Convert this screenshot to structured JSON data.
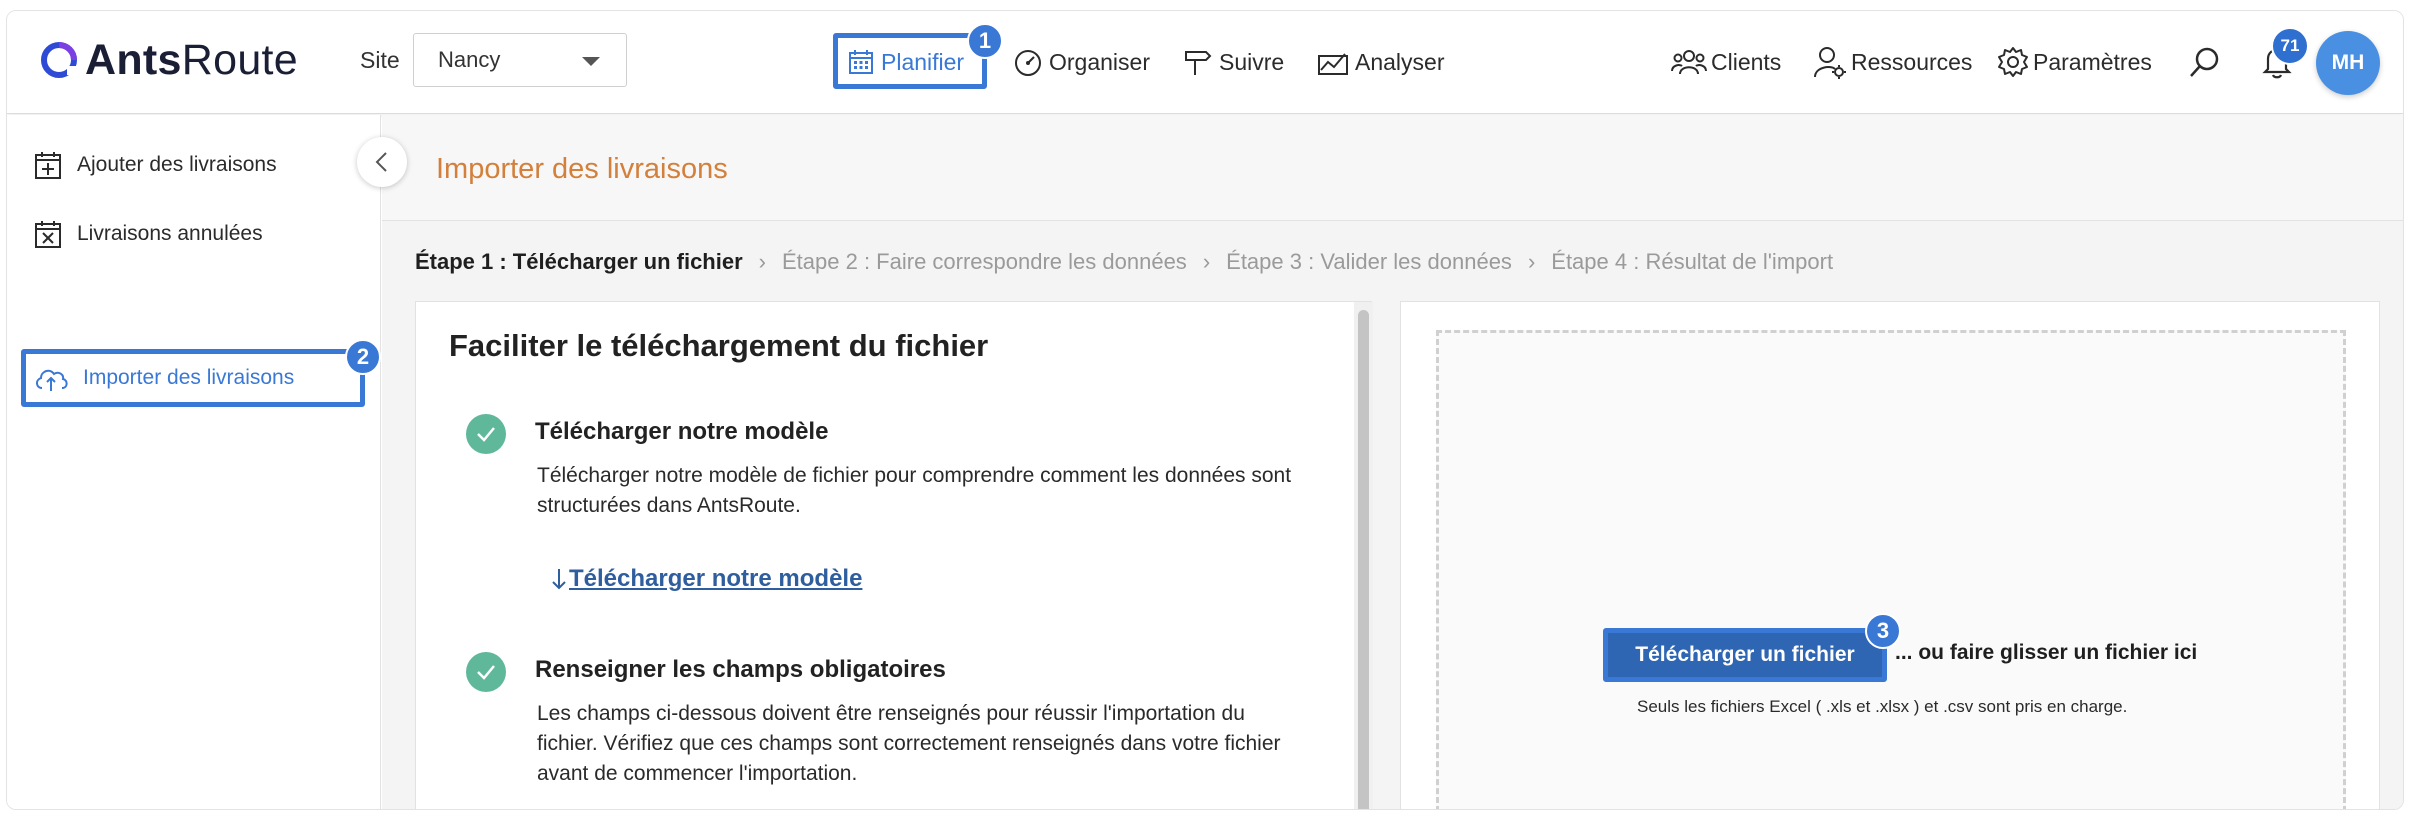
{
  "app": {
    "logo_bold": "Ants",
    "logo_light": "Route"
  },
  "site": {
    "label": "Site",
    "selected": "Nancy"
  },
  "nav": {
    "items": [
      {
        "label": "Planifier",
        "icon": "calendar-icon",
        "active": true
      },
      {
        "label": "Organiser",
        "icon": "gauge-icon"
      },
      {
        "label": "Suivre",
        "icon": "signpost-icon"
      },
      {
        "label": "Analyser",
        "icon": "chart-icon"
      }
    ],
    "right": [
      {
        "label": "Clients",
        "icon": "people-icon"
      },
      {
        "label": "Ressources",
        "icon": "user-gear-icon"
      },
      {
        "label": "Paramètres",
        "icon": "gear-icon"
      }
    ],
    "notifications": "71",
    "avatar": "MH",
    "accent": "#3a78d6"
  },
  "annotations": {
    "one": "1",
    "two": "2",
    "three": "3"
  },
  "sidebar": {
    "items": [
      {
        "label": "Ajouter des livraisons",
        "icon": "add-box-icon"
      },
      {
        "label": "Livraisons annulées",
        "icon": "cancel-box-icon"
      },
      {
        "label": "Importer des livraisons",
        "icon": "cloud-upload-icon",
        "active": true
      }
    ]
  },
  "page": {
    "title": "Importer des livraisons",
    "title_color": "#d2803c"
  },
  "steps": [
    "Étape 1 : Télécharger un fichier",
    "Étape 2 : Faire correspondre les données",
    "Étape 3 : Valider les données",
    "Étape 4 : Résultat de l'import"
  ],
  "left_card": {
    "title": "Faciliter le téléchargement du fichier",
    "section1_title": "Télécharger notre modèle",
    "section1_text": "Télécharger notre modèle de fichier pour comprendre comment les données sont structurées dans AntsRoute.",
    "download_link": "Télécharger notre modèle",
    "section2_title": "Renseigner les champs obligatoires",
    "section2_text": "Les champs ci-dessous doivent être renseignés pour réussir l'importation du fichier. Vérifiez que ces champs sont correctement renseignés dans votre fichier avant de commencer l'importation."
  },
  "right_card": {
    "upload_button": "Télécharger un fichier",
    "drop_text": "... ou faire glisser un fichier ici",
    "note": "Seuls les fichiers Excel ( .xls et .xlsx ) et .csv sont pris en charge."
  }
}
